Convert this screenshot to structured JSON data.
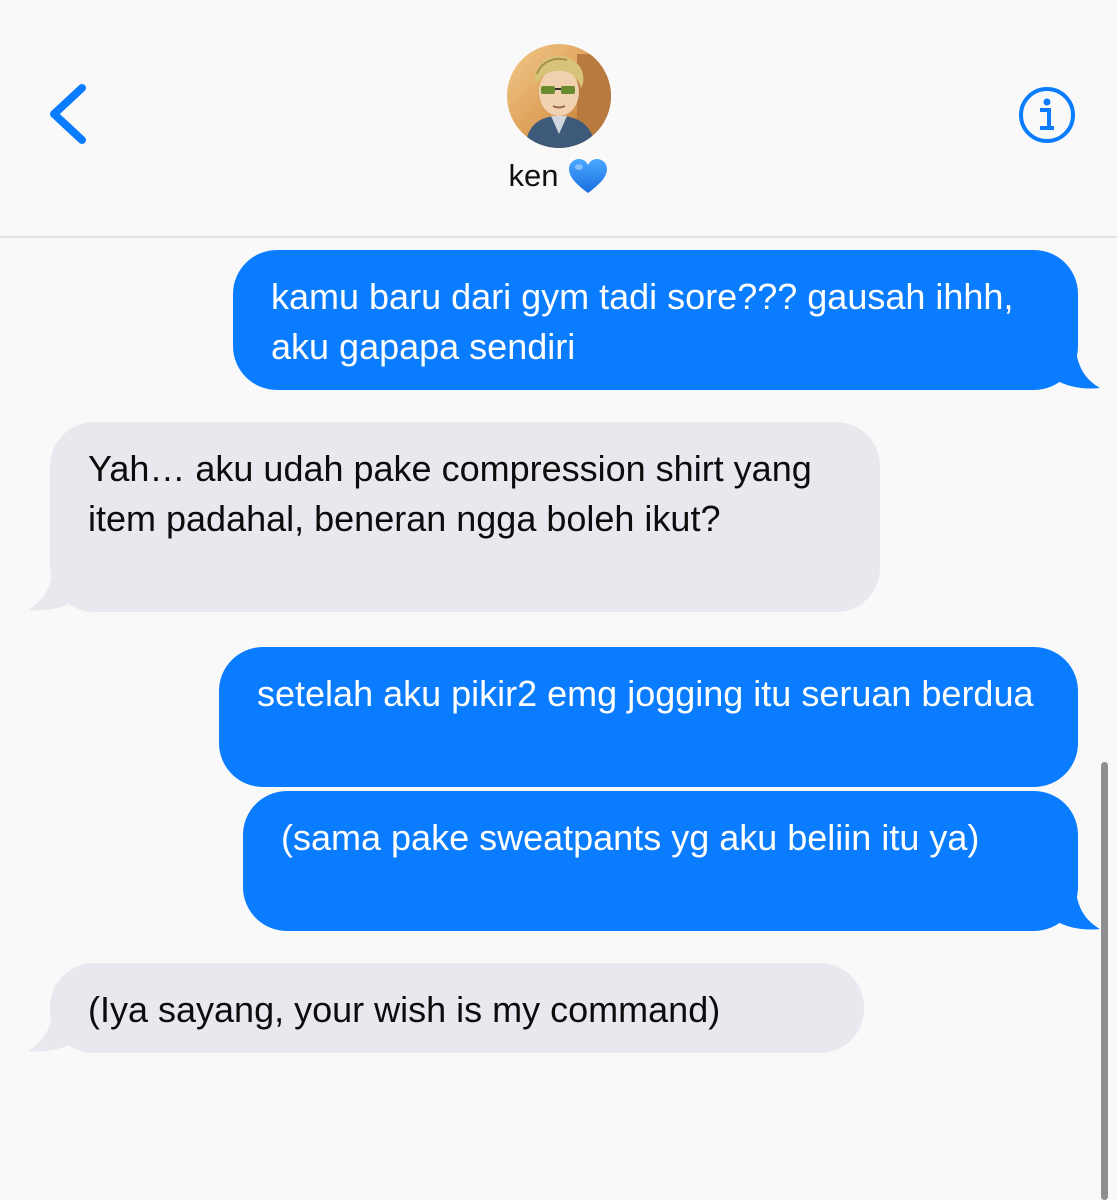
{
  "header": {
    "contact_name": "ken",
    "contact_emoji": "blue-heart",
    "back_icon": "chevron-left-icon",
    "info_icon": "info-icon",
    "accent_color": "#0a7cff"
  },
  "messages": [
    {
      "from": "me",
      "text": "kamu baru dari gym tadi sore??? gausah ihhh, aku gapapa sendiri"
    },
    {
      "from": "them",
      "text": "Yah… aku udah pake compression shirt yang item padahal, beneran ngga boleh ikut?"
    },
    {
      "from": "me",
      "text": "setelah aku pikir2 emg jogging itu seruan berdua"
    },
    {
      "from": "me",
      "text": "(sama pake sweatpants yg aku beliin itu ya)"
    },
    {
      "from": "them",
      "text": "(Iya sayang, your wish is my command)"
    }
  ],
  "colors": {
    "sent_bubble": "#0a7cff",
    "received_bubble": "#e9e8ee",
    "background": "#f9f9f9"
  }
}
